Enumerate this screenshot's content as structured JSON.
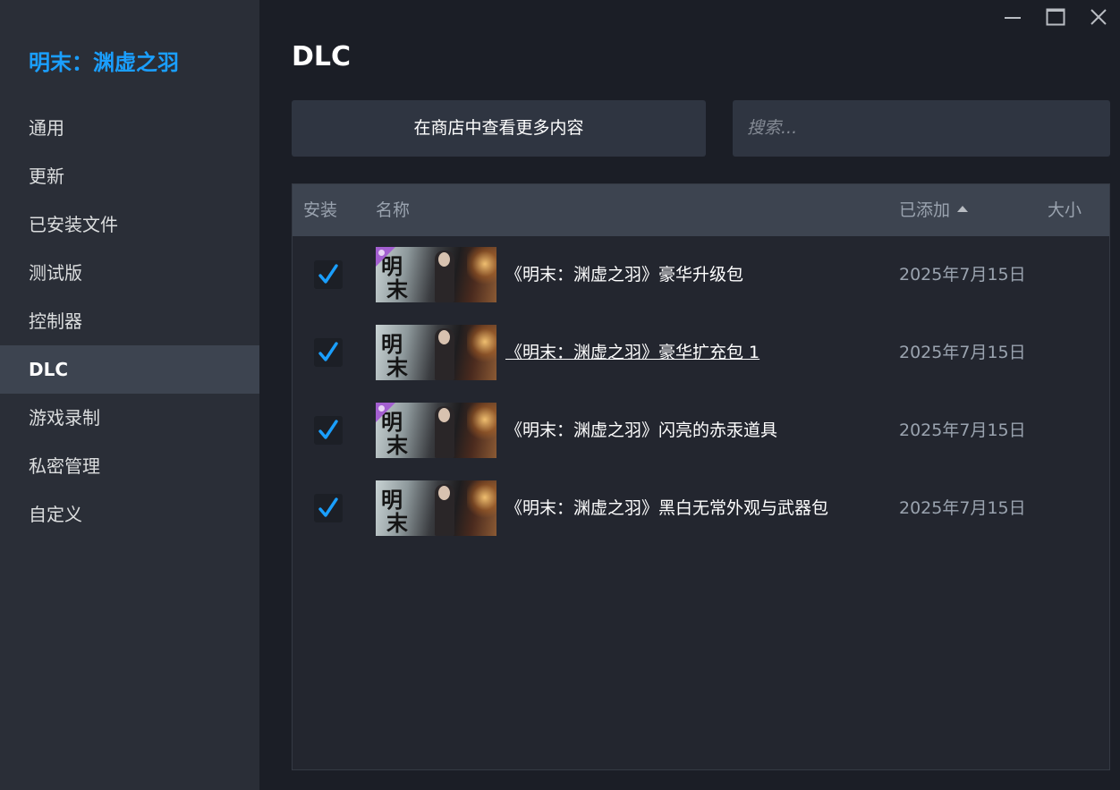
{
  "sidebar": {
    "game_title": "明末：渊虚之羽",
    "items": [
      {
        "label": "通用"
      },
      {
        "label": "更新"
      },
      {
        "label": "已安装文件"
      },
      {
        "label": "测试版"
      },
      {
        "label": "控制器"
      },
      {
        "label": "DLC"
      },
      {
        "label": "游戏录制"
      },
      {
        "label": "私密管理"
      },
      {
        "label": "自定义"
      }
    ],
    "active_item": "DLC"
  },
  "window_controls": {
    "minimize_icon": "minimize-icon",
    "maximize_icon": "maximize-icon",
    "close_icon": "close-icon"
  },
  "main": {
    "title": "DLC",
    "store_button_label": "在商店中查看更多内容",
    "search_placeholder": "搜索..."
  },
  "table": {
    "headers": {
      "install": "安装",
      "name": "名称",
      "added": "已添加",
      "size": "大小"
    },
    "sort_column": "已添加",
    "sort_direction": "ascending",
    "rows": [
      {
        "installed": true,
        "name": "《明末：渊虚之羽》豪华升级包",
        "added": "2025年7月15日",
        "badge": true
      },
      {
        "installed": true,
        "name": "《明末：渊虚之羽》豪华扩充包 1",
        "added": "2025年7月15日",
        "badge": false
      },
      {
        "installed": true,
        "name": "《明末：渊虚之羽》闪亮的赤汞道具",
        "added": "2025年7月15日",
        "badge": true
      },
      {
        "installed": true,
        "name": "《明末：渊虚之羽》黑白无常外观与武器包",
        "added": "2025年7月15日",
        "badge": false
      }
    ]
  },
  "colors": {
    "accent": "#1a9fff",
    "sidebar_bg": "#2a2e37",
    "main_bg": "#1b1e26",
    "active_item_bg": "#3d4450"
  }
}
